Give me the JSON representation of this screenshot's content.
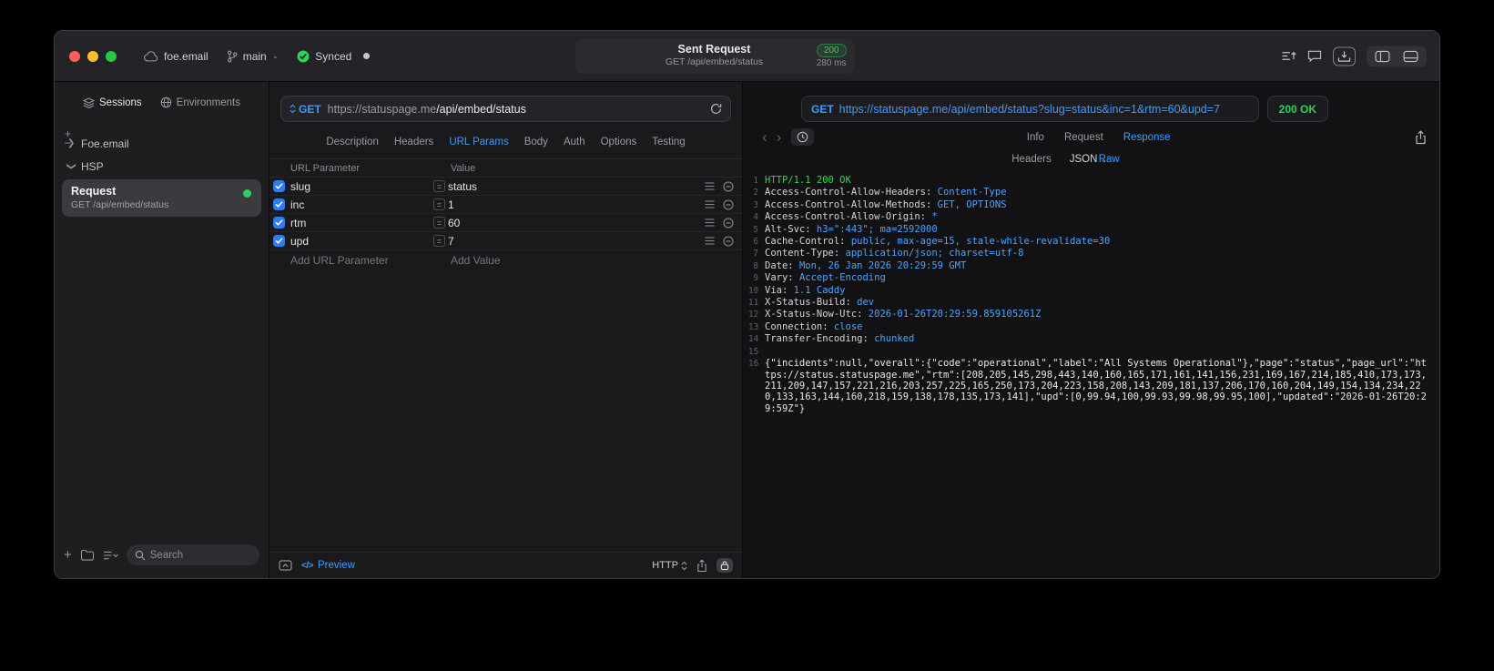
{
  "colors": {
    "accent": "#3d9bff",
    "success_green": "#30d158"
  },
  "titlebar": {
    "project": "foe.email",
    "branch": "main",
    "sync_label": "Synced",
    "request_summary": {
      "title": "Sent Request",
      "status_code": "200",
      "method_path": "GET /api/embed/status",
      "duration": "280 ms"
    }
  },
  "sidebar": {
    "tabs": [
      {
        "label": "Sessions",
        "active": true
      },
      {
        "label": "Environments",
        "active": false
      }
    ],
    "tree": [
      {
        "label": "Foe.email",
        "expanded": false
      },
      {
        "label": "HSP",
        "expanded": true
      }
    ],
    "request_item": {
      "title": "Request",
      "subtitle": "GET /api/embed/status"
    },
    "search_placeholder": "Search"
  },
  "request_panel": {
    "method": "GET",
    "url_host": "https://statuspage.me",
    "url_path": "/api/embed/status",
    "tabs": [
      "Description",
      "Headers",
      "URL Params",
      "Body",
      "Auth",
      "Options",
      "Testing"
    ],
    "active_tab": "URL Params",
    "params": {
      "columns": [
        "URL Parameter",
        "Value"
      ],
      "rows": [
        {
          "key": "slug",
          "value": "status",
          "enabled": true
        },
        {
          "key": "inc",
          "value": "1",
          "enabled": true
        },
        {
          "key": "rtm",
          "value": "60",
          "enabled": true
        },
        {
          "key": "upd",
          "value": "7",
          "enabled": true
        }
      ],
      "add_key_placeholder": "Add URL Parameter",
      "add_value_placeholder": "Add Value"
    },
    "footer": {
      "preview_label": "Preview",
      "protocol": "HTTP"
    }
  },
  "response_panel": {
    "method": "GET",
    "url": "https://statuspage.me/api/embed/status?slug=status&inc=1&rtm=60&upd=7",
    "status": "200 OK",
    "tabs": [
      "Info",
      "Request",
      "Response"
    ],
    "active_tab": "Response",
    "view_tabs": [
      "Headers",
      "JSON",
      "Raw"
    ],
    "active_view": "Raw",
    "lines": [
      {
        "num": "1",
        "kind": "status",
        "text": "HTTP/1.1 200 OK"
      },
      {
        "num": "2",
        "kind": "header",
        "name": "Access-Control-Allow-Headers:",
        "value": "Content-Type"
      },
      {
        "num": "3",
        "kind": "header",
        "name": "Access-Control-Allow-Methods:",
        "value": "GET, OPTIONS"
      },
      {
        "num": "4",
        "kind": "header",
        "name": "Access-Control-Allow-Origin:",
        "value": "*"
      },
      {
        "num": "5",
        "kind": "header",
        "name": "Alt-Svc:",
        "value": "h3=\":443\"; ma=2592000"
      },
      {
        "num": "6",
        "kind": "header",
        "name": "Cache-Control:",
        "value": "public, max-age=15, stale-while-revalidate=30"
      },
      {
        "num": "7",
        "kind": "header",
        "name": "Content-Type:",
        "value": "application/json; charset=utf-8"
      },
      {
        "num": "8",
        "kind": "header",
        "name": "Date:",
        "value": "Mon, 26 Jan 2026 20:29:59 GMT"
      },
      {
        "num": "9",
        "kind": "header",
        "name": "Vary:",
        "value": "Accept-Encoding"
      },
      {
        "num": "10",
        "kind": "header",
        "name": "Via:",
        "value": "1.1 Caddy"
      },
      {
        "num": "11",
        "kind": "header",
        "name": "X-Status-Build:",
        "value": "dev"
      },
      {
        "num": "12",
        "kind": "header",
        "name": "X-Status-Now-Utc:",
        "value": "2026-01-26T20:29:59.859105261Z"
      },
      {
        "num": "13",
        "kind": "header",
        "name": "Connection:",
        "value": "close"
      },
      {
        "num": "14",
        "kind": "header",
        "name": "Transfer-Encoding:",
        "value": "chunked"
      },
      {
        "num": "15",
        "kind": "blank"
      },
      {
        "num": "16",
        "kind": "body",
        "text": "{\"incidents\":null,\"overall\":{\"code\":\"operational\",\"label\":\"All Systems Operational\"},\"page\":\"status\",\"page_url\":\"https://status.statuspage.me\",\"rtm\":[208,205,145,298,443,140,160,165,171,161,141,156,231,169,167,214,185,410,173,173,211,209,147,157,221,216,203,257,225,165,250,173,204,223,158,208,143,209,181,137,206,170,160,204,149,154,134,234,220,133,163,144,160,218,159,138,178,135,173,141],\"upd\":[0,99.94,100,99.93,99.98,99.95,100],\"updated\":\"2026-01-26T20:29:59Z\"}"
      }
    ]
  }
}
